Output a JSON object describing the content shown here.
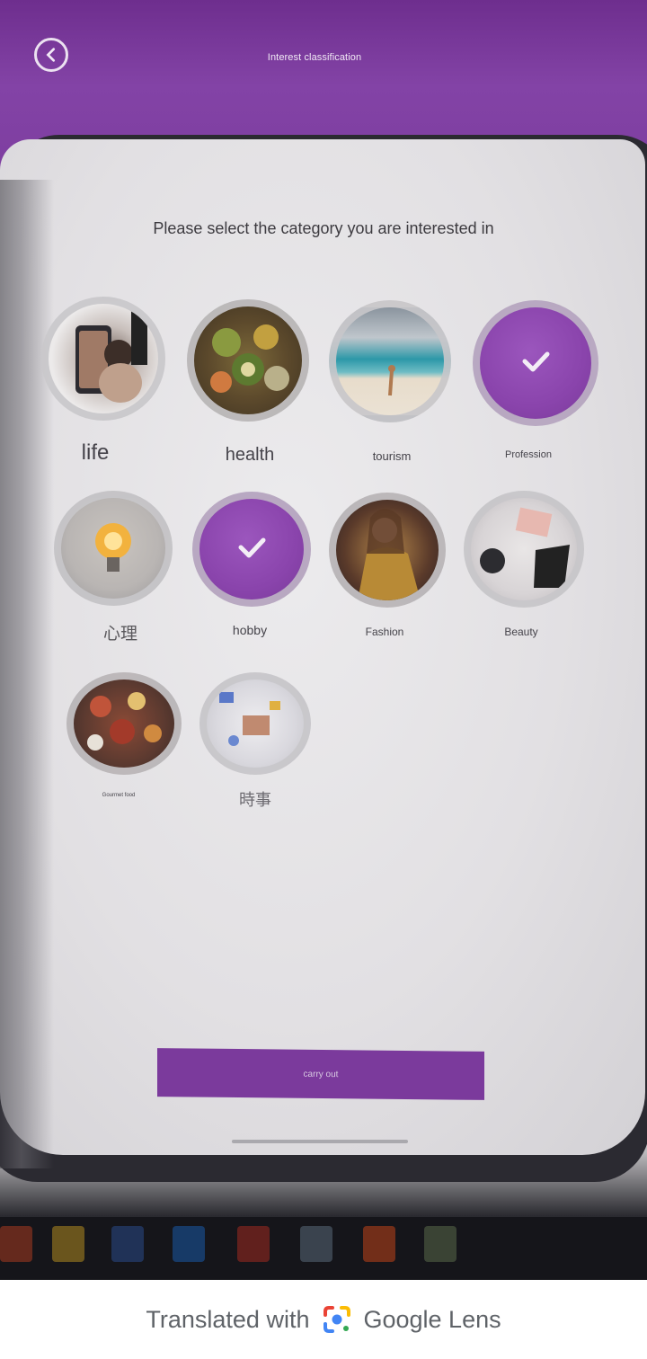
{
  "header": {
    "back_label": "Back",
    "title": "Interest classification"
  },
  "main": {
    "prompt": "Please select the category you are interested in",
    "categories": [
      {
        "label": "life",
        "selected": false,
        "icon": "selfie-photo"
      },
      {
        "label": "health",
        "selected": false,
        "icon": "salad-bowls-photo"
      },
      {
        "label": "tourism",
        "selected": false,
        "icon": "beach-photo"
      },
      {
        "label": "Profession",
        "selected": true,
        "icon": "check-icon"
      },
      {
        "label": "心理",
        "selected": false,
        "icon": "lightbulb-photo"
      },
      {
        "label": "hobby",
        "selected": true,
        "icon": "check-icon"
      },
      {
        "label": "Fashion",
        "selected": false,
        "icon": "portrait-photo"
      },
      {
        "label": "Beauty",
        "selected": false,
        "icon": "makeup-palette-photo"
      },
      {
        "label": "Gourmet food",
        "selected": false,
        "icon": "food-table-photo"
      },
      {
        "label": "時事",
        "selected": false,
        "icon": "desk-work-photo"
      }
    ],
    "done_button": "carry out"
  },
  "footer": {
    "lead": "Translated with",
    "brand": "Google Lens"
  },
  "colors": {
    "accent": "#7b3a9c",
    "header_bg": "#7d3c9e"
  }
}
